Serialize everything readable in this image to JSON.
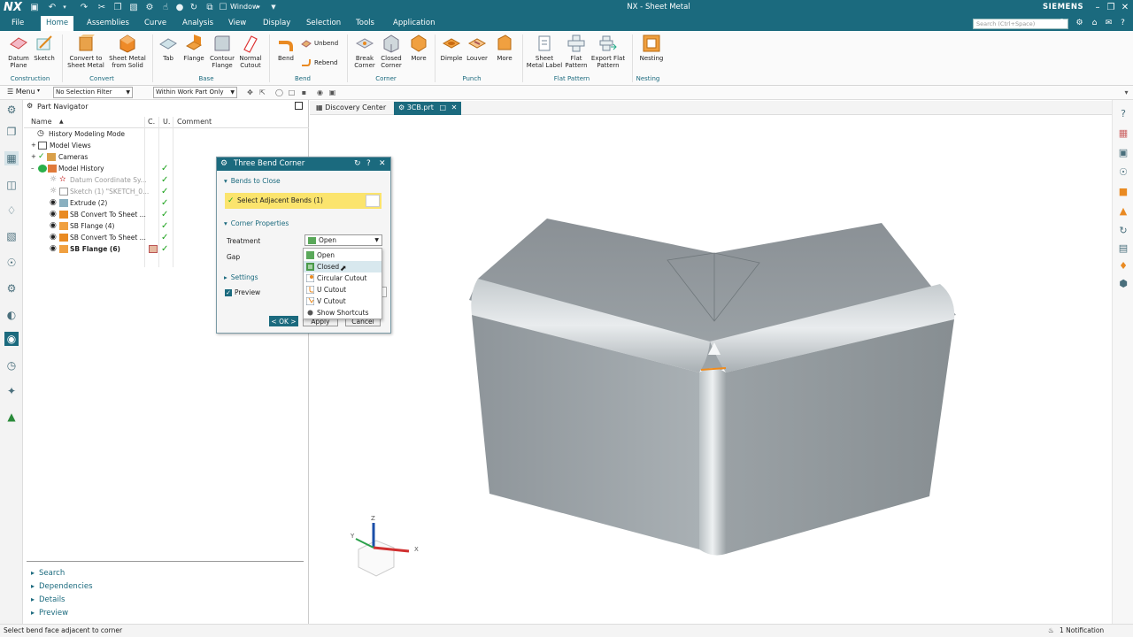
{
  "titlebar": {
    "logo": "NX",
    "window_label": "Window",
    "title": "NX - Sheet Metal",
    "brand": "SIEMENS"
  },
  "menubar": {
    "items": [
      "File",
      "Home",
      "Assemblies",
      "Curve",
      "Analysis",
      "View",
      "Display",
      "Selection",
      "Tools",
      "Application"
    ],
    "search_placeholder": "Search (Ctrl+Space)"
  },
  "ribbon": {
    "buttons": {
      "datum_plane": "Datum\nPlane",
      "sketch": "Sketch",
      "convert_to_sheet_metal": "Convert to\nSheet Metal",
      "sheet_metal_from_solid": "Sheet Metal\nfrom Solid",
      "tab": "Tab",
      "flange": "Flange",
      "contour_flange": "Contour\nFlange",
      "normal_cutout": "Normal\nCutout",
      "bend": "Bend",
      "unbend": "Unbend",
      "rebend": "Rebend",
      "break_corner": "Break\nCorner",
      "closed_corner": "Closed\nCorner",
      "more_corner": "More",
      "dimple": "Dimple",
      "louver": "Louver",
      "more_punch": "More",
      "sheet_metal_label": "Sheet\nMetal Label",
      "flat_pattern": "Flat\nPattern",
      "export_flat_pattern": "Export Flat\nPattern",
      "nesting": "Nesting"
    },
    "groups": [
      "Construction",
      "Convert",
      "Base",
      "Bend",
      "Corner",
      "Punch",
      "Flat Pattern",
      "Nesting"
    ]
  },
  "selection_bar": {
    "menu_label": "Menu",
    "filter": "No Selection Filter",
    "scope": "Within Work Part Only"
  },
  "navigator": {
    "title": "Part Navigator",
    "columns": [
      "Name",
      "C.",
      "U.",
      "Comment"
    ],
    "rows": [
      {
        "label": "History Modeling Mode"
      },
      {
        "label": "Model Views"
      },
      {
        "label": "Cameras"
      },
      {
        "label": "Model History"
      },
      {
        "label": "Datum Coordinate Sy..."
      },
      {
        "label": "Sketch (1) \"SKETCH_0..."
      },
      {
        "label": "Extrude (2)"
      },
      {
        "label": "SB Convert To Sheet ..."
      },
      {
        "label": "SB Flange (4)"
      },
      {
        "label": "SB Convert To Sheet ..."
      },
      {
        "label": "SB Flange (6)"
      }
    ],
    "sections": [
      "Search",
      "Dependencies",
      "Details",
      "Preview"
    ]
  },
  "tabs": [
    "Discovery Center",
    "3CB.prt"
  ],
  "dialog": {
    "title": "Three Bend Corner",
    "section_bends": "Bends to Close",
    "select_label": "Select Adjacent Bends (1)",
    "section_corner": "Corner Properties",
    "treatment_label": "Treatment",
    "treatment_value": "Open",
    "gap_label": "Gap",
    "section_settings": "Settings",
    "preview_label": "Preview",
    "ok": "< OK >",
    "apply": "Apply",
    "cancel": "Cancel"
  },
  "treatment_options": [
    "Open",
    "Closed",
    "Circular Cutout",
    "U Cutout",
    "V Cutout",
    "Show Shortcuts"
  ],
  "triad": {
    "z": "Z",
    "x": "X",
    "y": "Y"
  },
  "statusbar": {
    "message": "Select bend face adjacent to corner",
    "notification": "1 Notification"
  },
  "colors": {
    "accent": "#1b6a7e",
    "highlight": "#fbe46d",
    "check": "#1aa11a"
  }
}
